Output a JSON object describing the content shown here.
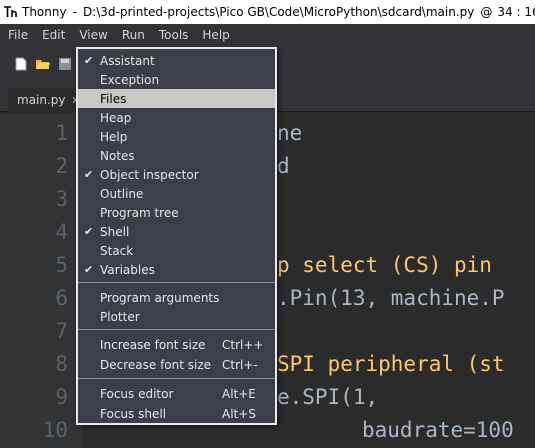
{
  "window": {
    "app_name": "Thonny",
    "separator": "-",
    "path": "D:\\3d-printed-projects\\Pico GB\\Code\\MicroPython\\sdcard\\main.py",
    "at": "@",
    "cursor": "34 : 16"
  },
  "menubar": [
    "File",
    "Edit",
    "View",
    "Run",
    "Tools",
    "Help"
  ],
  "toolbar": {
    "icons": [
      "new-file-icon",
      "open-folder-icon",
      "save-icon"
    ]
  },
  "tab": {
    "label": "main.py",
    "close": "×"
  },
  "editor": {
    "line_numbers": [
      "1",
      "2",
      "3",
      "4",
      "5",
      "6",
      "7",
      "8",
      "9",
      "10"
    ],
    "visible_code": [
      {
        "line": "1",
        "text": "ne"
      },
      {
        "line": "2",
        "text": "d"
      },
      {
        "line": "5",
        "text": "p select (CS) pin"
      },
      {
        "line": "6",
        "text": ".Pin(13, machine.P"
      },
      {
        "line": "8",
        "text": "SPI peripheral (st"
      },
      {
        "line": "9",
        "text": "e.SPI(1,"
      },
      {
        "line": "10",
        "text": "baudrate=100"
      }
    ]
  },
  "view_menu": {
    "items": [
      {
        "label": "Assistant",
        "checked": true
      },
      {
        "label": "Exception",
        "checked": false
      },
      {
        "label": "Files",
        "checked": false,
        "highlighted": true
      },
      {
        "label": "Heap",
        "checked": false
      },
      {
        "label": "Help",
        "checked": false
      },
      {
        "label": "Notes",
        "checked": false
      },
      {
        "label": "Object inspector",
        "checked": true
      },
      {
        "label": "Outline",
        "checked": false
      },
      {
        "label": "Program tree",
        "checked": false
      },
      {
        "label": "Shell",
        "checked": true
      },
      {
        "label": "Stack",
        "checked": false
      },
      {
        "label": "Variables",
        "checked": true
      },
      {
        "label": "Program arguments",
        "checked": false
      },
      {
        "label": "Plotter",
        "checked": false
      },
      {
        "label": "Increase font size",
        "shortcut": "Ctrl++"
      },
      {
        "label": "Decrease font size",
        "shortcut": "Ctrl+-"
      },
      {
        "label": "Focus editor",
        "shortcut": "Alt+E"
      },
      {
        "label": "Focus shell",
        "shortcut": "Alt+S"
      }
    ],
    "check_glyph": "✔"
  },
  "colors": {
    "menu_bg": "#3b3e46",
    "highlight": "#c7c7c7",
    "editor_bg": "#2b2b2b",
    "code_yellow": "#ffc66d"
  }
}
